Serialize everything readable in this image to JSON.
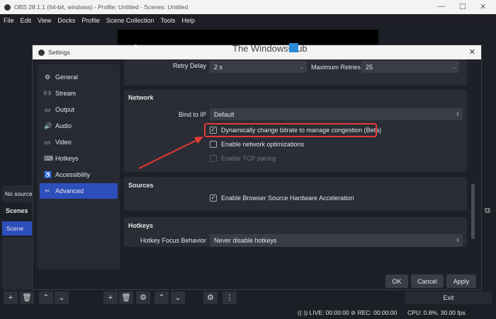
{
  "window": {
    "title": "OBS 28.1.1 (64-bit, windows) - Profile: Untitled - Scenes: Untitled",
    "minimize": "—",
    "maximize": "☐",
    "close": "✕"
  },
  "menu": [
    "File",
    "Edit",
    "View",
    "Docks",
    "Profile",
    "Scene Collection",
    "Tools",
    "Help"
  ],
  "watermark": "The WindowsClub",
  "background": {
    "sources_empty": "No source",
    "scenes_header": "Scenes",
    "scene_item": "Scene",
    "exit": "Exit"
  },
  "status": {
    "live": "LIVE: 00:00:00",
    "rec": "REC: 00:00:00",
    "cpu": "CPU: 0.8%, 30.00 fps"
  },
  "settings": {
    "title": "Settings",
    "close": "✕",
    "sidebar": [
      {
        "label": "General",
        "icon": "⚙"
      },
      {
        "label": "Stream",
        "icon": "((·))"
      },
      {
        "label": "Output",
        "icon": "▭"
      },
      {
        "label": "Audio",
        "icon": "🔊"
      },
      {
        "label": "Video",
        "icon": "▭"
      },
      {
        "label": "Hotkeys",
        "icon": "⌨"
      },
      {
        "label": "Accessibility",
        "icon": "♿"
      },
      {
        "label": "Advanced",
        "icon": "✂"
      }
    ],
    "active": "Advanced",
    "retry": {
      "delay_label": "Retry Delay",
      "delay_value": "2 s",
      "max_label": "Maximum Retries",
      "max_value": "25"
    },
    "network": {
      "header": "Network",
      "bind_label": "Bind to IP",
      "bind_value": "Default",
      "dynamic_bitrate": "Dynamically change bitrate to manage congestion (Beta)",
      "network_opt": "Enable network optimizations",
      "tcp_pacing": "Enable TCP pacing"
    },
    "sources": {
      "header": "Sources",
      "browser_accel": "Enable Browser Source Hardware Acceleration"
    },
    "hotkeys": {
      "header": "Hotkeys",
      "focus_label": "Hotkey Focus Behavior",
      "focus_value": "Never disable hotkeys"
    },
    "buttons": {
      "ok": "OK",
      "cancel": "Cancel",
      "apply": "Apply"
    }
  },
  "colors": {
    "accent": "#2d4fbc",
    "highlight": "#e53935"
  }
}
